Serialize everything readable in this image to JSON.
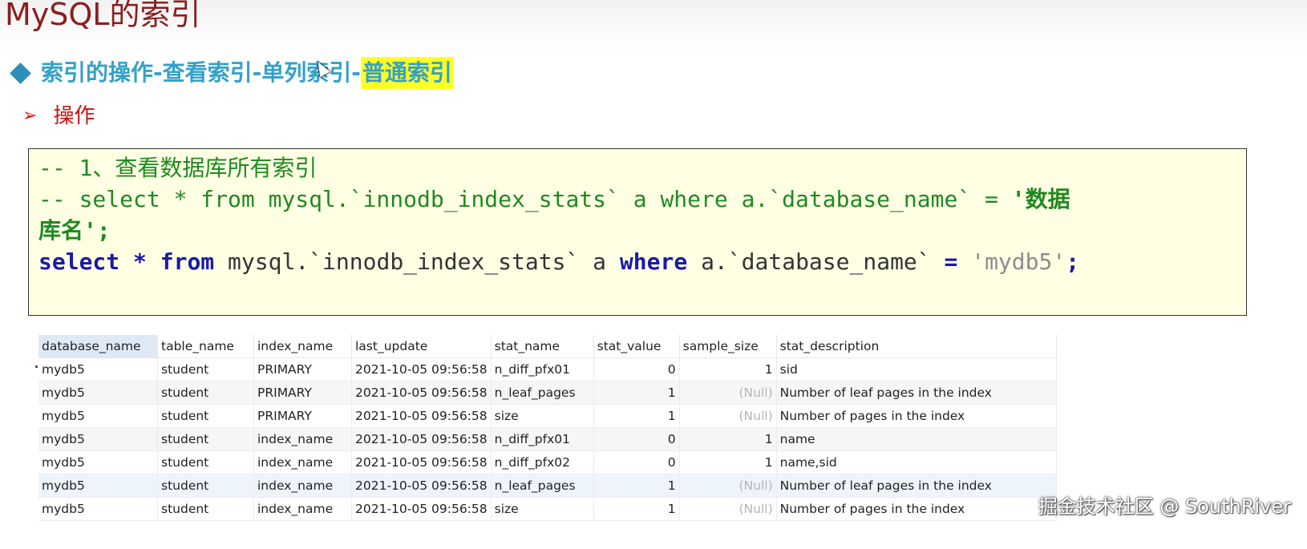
{
  "title": "MySQL的索引",
  "heading": {
    "text": "索引的操作-查看索引-单列索引-",
    "highlight": "普通索引"
  },
  "sub": {
    "arrow": "➢",
    "label": "操作"
  },
  "code": {
    "line1": "-- 1、查看数据库所有索引",
    "line2_a": "-- select * from mysql.`innodb_index_stats` a where a.`database_name` = ",
    "line2_b": "'数据",
    "line3": "库名';",
    "line4": {
      "kw_select": "select",
      "star": "*",
      "kw_from": "from",
      "table": "mysql.`innodb_index_stats` a",
      "kw_where": "where",
      "col": "a.`database_name`",
      "eq": "=",
      "value": "'mydb5'",
      "end": ";"
    }
  },
  "grid": {
    "columns": [
      "database_name",
      "table_name",
      "index_name",
      "last_update",
      "stat_name",
      "stat_value",
      "sample_size",
      "stat_description"
    ],
    "rows": [
      [
        "mydb5",
        "student",
        "PRIMARY",
        "2021-10-05 09:56:58",
        "n_diff_pfx01",
        "0",
        "1",
        "sid"
      ],
      [
        "mydb5",
        "student",
        "PRIMARY",
        "2021-10-05 09:56:58",
        "n_leaf_pages",
        "1",
        "(Null)",
        "Number of leaf pages in the index"
      ],
      [
        "mydb5",
        "student",
        "PRIMARY",
        "2021-10-05 09:56:58",
        "size",
        "1",
        "(Null)",
        "Number of pages in the index"
      ],
      [
        "mydb5",
        "student",
        "index_name",
        "2021-10-05 09:56:58",
        "n_diff_pfx01",
        "0",
        "1",
        "name"
      ],
      [
        "mydb5",
        "student",
        "index_name",
        "2021-10-05 09:56:58",
        "n_diff_pfx02",
        "0",
        "1",
        "name,sid"
      ],
      [
        "mydb5",
        "student",
        "index_name",
        "2021-10-05 09:56:58",
        "n_leaf_pages",
        "1",
        "(Null)",
        "Number of leaf pages in the index"
      ],
      [
        "mydb5",
        "student",
        "index_name",
        "2021-10-05 09:56:58",
        "size",
        "1",
        "(Null)",
        "Number of pages in the index"
      ]
    ]
  },
  "watermark": "掘金技术社区 @ SouthRiver",
  "colors": {
    "title": "#8a1f1f",
    "heading": "#35a1c7",
    "highlight": "#ffff24",
    "code_bg": "#ffffe4",
    "comment": "#1f8a1f",
    "keyword": "#1a1aa8"
  }
}
